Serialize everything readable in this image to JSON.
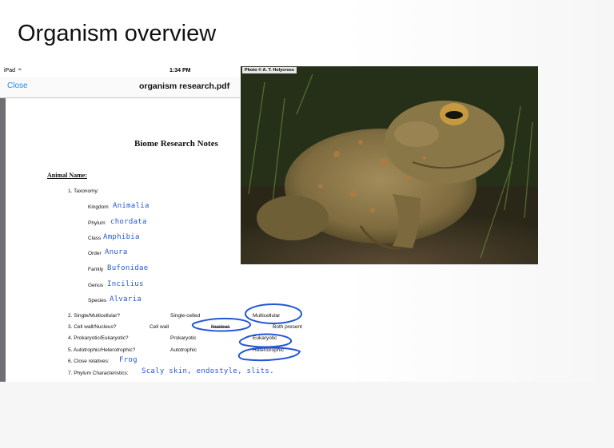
{
  "slide": {
    "title": "Organism overview"
  },
  "ipad": {
    "status": {
      "carrier": "iPad",
      "time": "1:34 PM"
    },
    "nav": {
      "close": "Close",
      "title": "organism research.pdf"
    }
  },
  "document": {
    "heading": "Biome Research Notes",
    "animal_name_label": "Animal Name:",
    "taxonomy_label": "1.  Taxonomy:",
    "taxonomy": [
      {
        "rank": "Kingdom",
        "value": "Animalia"
      },
      {
        "rank": "Phylum",
        "value": "chordata"
      },
      {
        "rank": "Class",
        "value": "Amphibia"
      },
      {
        "rank": "Order",
        "value": "Anura"
      },
      {
        "rank": "Family",
        "value": "Bufonidae"
      },
      {
        "rank": "Genus",
        "value": "Incilius"
      },
      {
        "rank": "Species",
        "value": "Alvaria"
      }
    ],
    "questions": [
      {
        "q": "2.  Single/Multicellular?",
        "a": "Single-celled",
        "b": "Multicellular"
      },
      {
        "q": "3.  Cell wall/Nucleus?",
        "a": "Cell wall",
        "b": "Nucleus",
        "c": "Both present"
      },
      {
        "q": "4.  Prokaryotic/Eukaryotic?",
        "a": "Prokaryotic",
        "b": "Eukaryotic"
      },
      {
        "q": "5.  Autotrophic/Heterotrophic?",
        "a": "Autotrophic",
        "b": "Heterotrophic"
      },
      {
        "q": "6.  Close relatives:",
        "answer": "Frog"
      },
      {
        "q": "7.  Phylum Characteristics:",
        "answer": "Scaly skin, endostyle, slits."
      }
    ],
    "ink_color": "#2457d6"
  },
  "photo": {
    "credit": "Photo © A. T. Holycross",
    "subject": "toad"
  }
}
